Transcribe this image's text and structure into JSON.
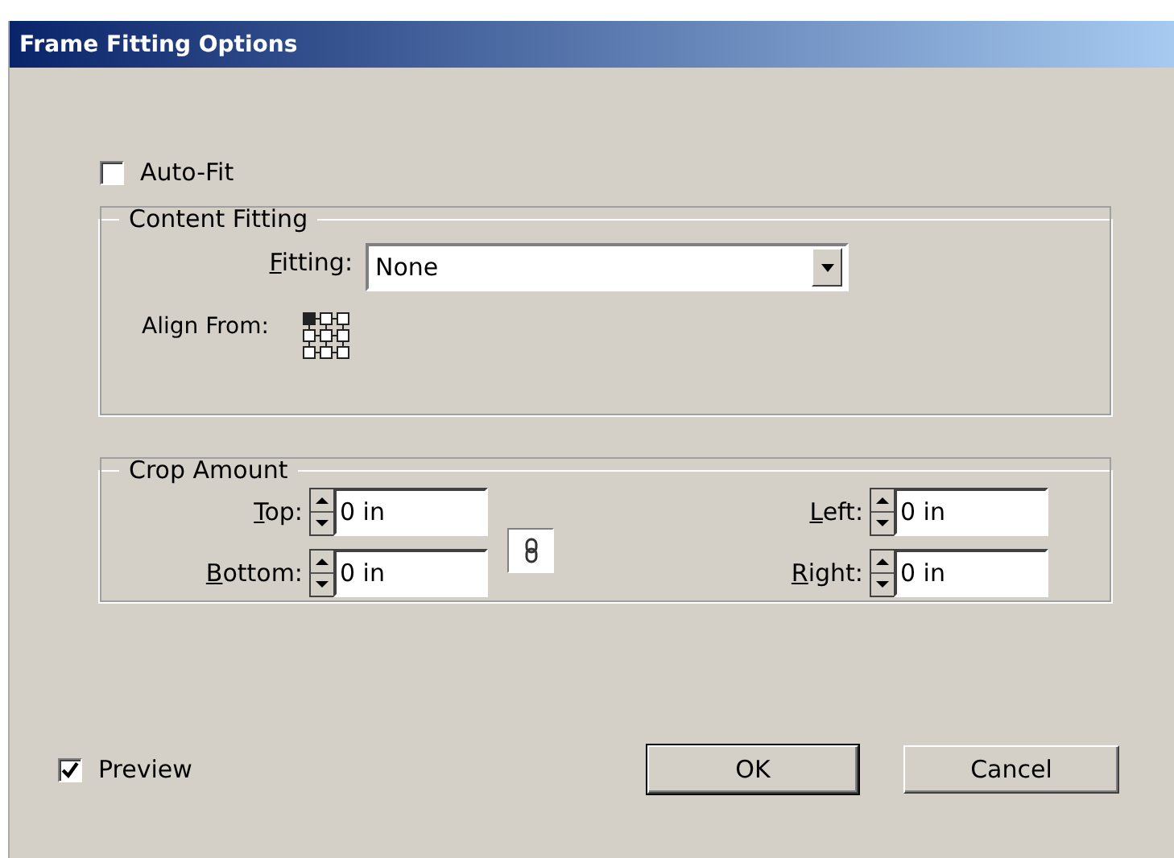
{
  "window": {
    "title": "Frame Fitting Options"
  },
  "auto_fit": {
    "label": "Auto-Fit",
    "checked": false
  },
  "content_fitting": {
    "title": "Content Fitting",
    "fitting": {
      "label": "Fitting:",
      "mnemonic": true,
      "value": "None"
    },
    "align_from": {
      "label": "Align From:",
      "points": [
        {
          "selected": true
        },
        {
          "selected": false
        },
        {
          "selected": false
        },
        {
          "selected": false
        },
        {
          "selected": false
        },
        {
          "selected": false
        },
        {
          "selected": false
        },
        {
          "selected": false
        },
        {
          "selected": false
        }
      ]
    }
  },
  "crop_amount": {
    "title": "Crop Amount",
    "fields": [
      {
        "label": "Top:",
        "mnemonic": true,
        "value": "0 in"
      },
      {
        "label": "Left:",
        "mnemonic": true,
        "value": "0 in"
      },
      {
        "label": "Bottom:",
        "mnemonic": true,
        "value": "0 in"
      },
      {
        "label": "Right:",
        "mnemonic": true,
        "value": "0 in"
      }
    ]
  },
  "preview": {
    "label": "Preview",
    "checked": true
  },
  "buttons": [
    {
      "label": "OK",
      "default": true
    },
    {
      "label": "Cancel",
      "default": false
    }
  ]
}
